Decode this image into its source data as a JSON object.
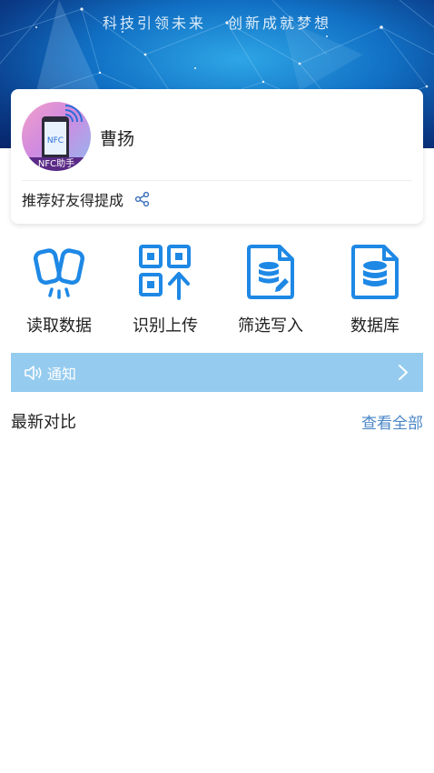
{
  "banner": {
    "slogan_left": "科技引领未来",
    "slogan_right": "创新成就梦想"
  },
  "profile": {
    "avatar_text": "NFC",
    "avatar_label": "NFC助手",
    "name": "曹扬",
    "referral_text": "推荐好友得提成"
  },
  "actions": [
    {
      "label": "读取数据",
      "icon": "nfc-cards-icon"
    },
    {
      "label": "识别上传",
      "icon": "qr-upload-icon"
    },
    {
      "label": "筛选写入",
      "icon": "database-document-edit-icon"
    },
    {
      "label": "数据库",
      "icon": "database-document-icon"
    }
  ],
  "notice": {
    "text": "通知"
  },
  "recent": {
    "title": "最新对比",
    "view_all": "查看全部"
  },
  "colors": {
    "accent_blue": "#1e88e5",
    "notice_bg": "#95cbef",
    "link": "#4a86c6"
  }
}
